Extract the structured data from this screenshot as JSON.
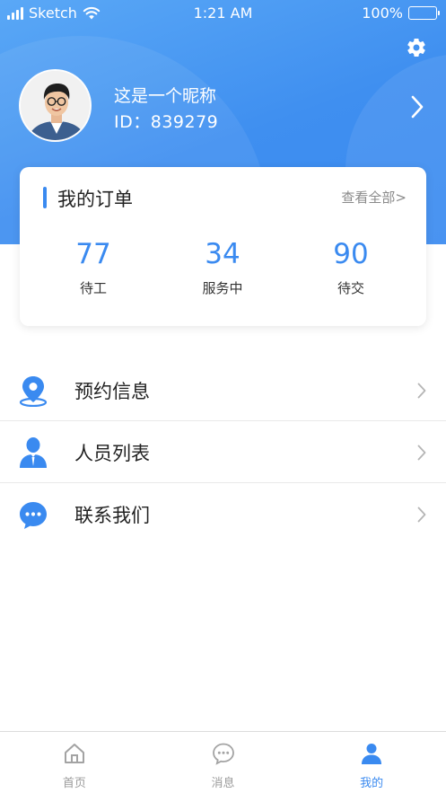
{
  "status_bar": {
    "carrier": "Sketch",
    "time": "1:21 AM",
    "battery": "100%"
  },
  "profile": {
    "nickname": "这是一个昵称",
    "id_text": "ID：839279"
  },
  "orders": {
    "title": "我的订单",
    "view_all": "查看全部>",
    "stats": [
      {
        "value": "77",
        "label": "待工"
      },
      {
        "value": "34",
        "label": "服务中"
      },
      {
        "value": "90",
        "label": "待交"
      }
    ]
  },
  "menu": [
    {
      "label": "预约信息",
      "icon": "location-pin-icon"
    },
    {
      "label": "人员列表",
      "icon": "person-icon"
    },
    {
      "label": "联系我们",
      "icon": "chat-bubble-icon"
    }
  ],
  "tabbar": {
    "tabs": [
      {
        "label": "首页",
        "icon": "home-icon",
        "active": false
      },
      {
        "label": "消息",
        "icon": "message-icon",
        "active": false
      },
      {
        "label": "我的",
        "icon": "user-icon",
        "active": true
      }
    ]
  },
  "colors": {
    "accent": "#3a8af0",
    "header_gradient_start": "#5aa8f6",
    "header_gradient_end": "#3a8af0"
  }
}
